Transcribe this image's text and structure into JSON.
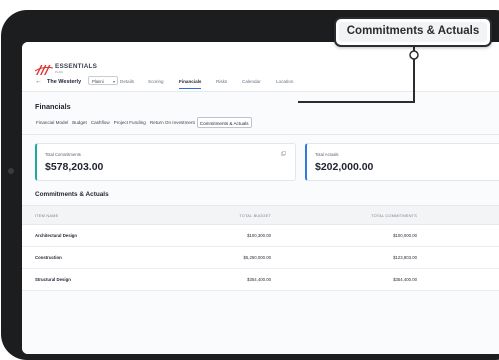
{
  "callout": {
    "label": "Commitments & Actuals"
  },
  "logo": {
    "text": "ESSENTIALS",
    "sub": "PLAN"
  },
  "header": {
    "project_name": "The Westerly",
    "phase": "Planni",
    "tabs": [
      {
        "label": "Details",
        "active": false
      },
      {
        "label": "Scoring",
        "active": false
      },
      {
        "label": "Financials",
        "active": true
      },
      {
        "label": "Risks",
        "active": false
      },
      {
        "label": "Calendar",
        "active": false
      },
      {
        "label": "Location",
        "active": false
      }
    ]
  },
  "page": {
    "title": "Financials"
  },
  "sub_tabs": [
    {
      "label": "Financial Model",
      "active": false
    },
    {
      "label": "Budget",
      "active": false
    },
    {
      "label": "Cashflow",
      "active": false
    },
    {
      "label": "Project Funding",
      "active": false
    },
    {
      "label": "Return On Investment",
      "active": false
    },
    {
      "label": "Commitments & Actuals",
      "active": true
    }
  ],
  "cards": {
    "commitments": {
      "label": "Total Commitments",
      "value": "$578,203.00"
    },
    "actuals": {
      "label": "Total Actuals",
      "value": "$202,000.00"
    }
  },
  "section": {
    "title": "Commitments & Actuals"
  },
  "table": {
    "headers": {
      "name": "ITEM NAME",
      "budget": "TOTAL BUDGET",
      "commitments": "TOTAL COMMITMENTS"
    },
    "rows": [
      {
        "name": "Architectural Design",
        "budget": "$100,300.00",
        "commitments": "$100,000.00"
      },
      {
        "name": "Construction",
        "budget": "$5,250,000.00",
        "commitments": "$123,803.00"
      },
      {
        "name": "Structural Design",
        "budget": "$354,400.00",
        "commitments": "$354,400.00"
      }
    ]
  },
  "colors": {
    "accent": "#2b6cdf",
    "commitments_border": "#1fa89f",
    "actuals_border": "#2d7be0",
    "tablet_frame": "#1c1d1f"
  }
}
